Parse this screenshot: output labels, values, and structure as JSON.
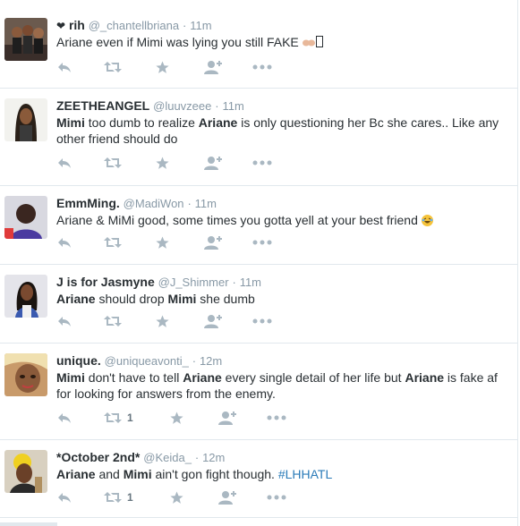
{
  "colors": {
    "icon": "#aab8c2",
    "link": "#2b7bb9",
    "meta": "#8899a6",
    "text": "#292f33",
    "divider": "#e1e8ed"
  },
  "tweets": [
    {
      "name": "rih",
      "name_prefix": "❤",
      "handle": "@_chantellbriana",
      "time": "11m",
      "parts": [
        {
          "t": "Ariane even if Mimi was lying you still FAKE "
        }
      ],
      "trailing": "hands-emoji + missing-glyph",
      "retweets": "",
      "favorites": ""
    },
    {
      "name": "ZEETHEANGEL",
      "handle": "@luuvzeee",
      "time": "11m",
      "parts": [
        {
          "b": "Mimi"
        },
        {
          "t": " too dumb to realize "
        },
        {
          "b": "Ariane"
        },
        {
          "t": " is only questioning her Bc she cares.. Like any other friend should do"
        }
      ],
      "retweets": "",
      "favorites": ""
    },
    {
      "name": "EmmMing.",
      "handle": "@MadiWon",
      "time": "11m",
      "parts": [
        {
          "t": "Ariane & MiMi good, some times you gotta yell at your best friend "
        }
      ],
      "trailing": "laughing-emoji",
      "retweets": "",
      "favorites": ""
    },
    {
      "name": "J is for Jasmyne",
      "handle": "@J_Shimmer",
      "time": "11m",
      "parts": [
        {
          "b": "Ariane"
        },
        {
          "t": " should drop "
        },
        {
          "b": "Mimi"
        },
        {
          "t": " she dumb"
        }
      ],
      "retweets": "",
      "favorites": ""
    },
    {
      "name": "unique.",
      "handle": "@uniqueavonti_",
      "time": "12m",
      "parts": [
        {
          "b": "Mimi"
        },
        {
          "t": " don't have to tell "
        },
        {
          "b": "Ariane"
        },
        {
          "t": " every single detail of her life but "
        },
        {
          "b": "Ariane"
        },
        {
          "t": " is fake af for looking for answers from the enemy."
        }
      ],
      "retweets": "1",
      "favorites": ""
    },
    {
      "name": "*October 2nd*",
      "handle": "@Keida_",
      "time": "12m",
      "parts": [
        {
          "b": "Ariane"
        },
        {
          "t": " and "
        },
        {
          "b": "Mimi"
        },
        {
          "t": " ain't gon fight though. "
        },
        {
          "h": "#LHHATL"
        }
      ],
      "retweets": "1",
      "favorites": ""
    }
  ],
  "separator": "·"
}
